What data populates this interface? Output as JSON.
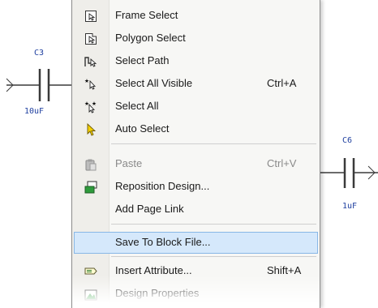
{
  "schematic": {
    "c3": {
      "ref": "C3",
      "value": "10uF"
    },
    "c6": {
      "ref": "C6",
      "value": "1uF"
    }
  },
  "context_menu": {
    "items": [
      {
        "label": "Frame Select",
        "shortcut": "",
        "icon": "frame-select-icon"
      },
      {
        "label": "Polygon Select",
        "shortcut": "",
        "icon": "polygon-select-icon"
      },
      {
        "label": "Select Path",
        "shortcut": "",
        "icon": "select-path-icon"
      },
      {
        "label": "Select All Visible",
        "shortcut": "Ctrl+A",
        "icon": "select-all-visible-icon"
      },
      {
        "label": "Select All",
        "shortcut": "",
        "icon": "select-all-icon"
      },
      {
        "label": "Auto Select",
        "shortcut": "",
        "icon": "auto-select-icon"
      },
      {
        "label": "Paste",
        "shortcut": "Ctrl+V",
        "icon": "paste-icon",
        "disabled": true
      },
      {
        "label": "Reposition Design...",
        "shortcut": "",
        "icon": "reposition-design-icon"
      },
      {
        "label": "Add Page Link",
        "shortcut": "",
        "icon": ""
      },
      {
        "label": "Save To Block File...",
        "shortcut": "",
        "icon": "",
        "highlighted": true
      },
      {
        "label": "Insert Attribute...",
        "shortcut": "Shift+A",
        "icon": "insert-attribute-icon"
      },
      {
        "label": "Design Properties",
        "shortcut": "",
        "icon": "design-properties-icon"
      }
    ]
  }
}
